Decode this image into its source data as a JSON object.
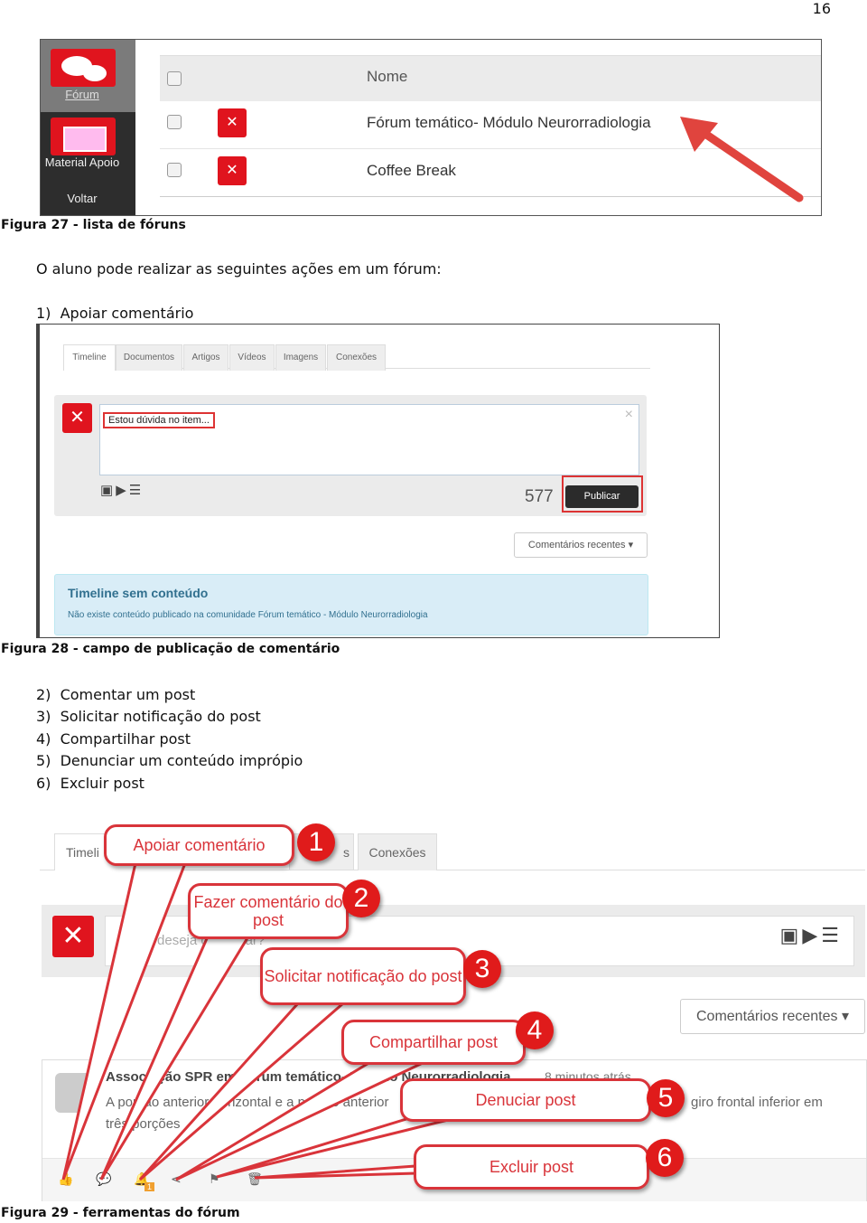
{
  "page_number": "16",
  "figure27": {
    "sidebar": [
      {
        "label": "Fórum",
        "icon": "chat-bubbles-icon"
      },
      {
        "label": "Material Apoio",
        "icon": "folder-icon"
      },
      {
        "label": "Voltar"
      }
    ],
    "header": "Nome",
    "rows": [
      "Fórum temático- Módulo Neurorradiologia",
      "Coffee Break"
    ],
    "caption": "Figura 27 - lista de fóruns"
  },
  "intro": "O aluno pode realizar as seguintes ações em um fórum:",
  "list1": [
    {
      "n": "1)",
      "t": "Apoiar comentário"
    }
  ],
  "figure28": {
    "tabs": [
      "Timeline",
      "Documentos",
      "Artigos",
      "Vídeos",
      "Imagens",
      "Conexões"
    ],
    "input_value": "Estou dúvida no item...",
    "close": "×",
    "char_count": "577",
    "publish": "Publicar",
    "sort": "Comentários recentes",
    "empty_title": "Timeline sem conteúdo",
    "empty_text": "Não existe conteúdo publicado na comunidade Fórum temático - Módulo Neurorradiologia",
    "caption": "Figura 28 - campo de publicação de comentário"
  },
  "list2": [
    {
      "n": "2)",
      "t": "Comentar um post"
    },
    {
      "n": "3)",
      "t": "Solicitar notificação do post"
    },
    {
      "n": "4)",
      "t": "Compartilhar post"
    },
    {
      "n": "5)",
      "t": "Denunciar um conteúdo imprópio"
    },
    {
      "n": "6)",
      "t": "Excluir post"
    }
  ],
  "figure29": {
    "tabs": [
      "Timeli",
      "s",
      "Conexões"
    ],
    "placeholder": "O que deseja comentar?",
    "sort": "Comentários recentes",
    "post_author": "Associação SPR em Fórum temático- Módulo Neurorradiologia",
    "post_time": "8 minutos atrás",
    "post_text1": "A porção anterior horizontal e a porção anterior",
    "post_text2": "giro frontal inferior em",
    "post_text3": "três porções",
    "badge": "1",
    "callouts": [
      {
        "n": "1",
        "t": "Apoiar comentário"
      },
      {
        "n": "2",
        "t": "Fazer comentário do post"
      },
      {
        "n": "3",
        "t": "Solicitar notificação do post"
      },
      {
        "n": "4",
        "t": "Compartilhar post"
      },
      {
        "n": "5",
        "t": "Denuciar post"
      },
      {
        "n": "6",
        "t": "Excluir post"
      }
    ],
    "caption": "Figura 29 - ferramentas do fórum"
  },
  "colors": {
    "brand_red": "#e0141e",
    "callout_red": "#d9343a",
    "info_bg": "#d9edf7"
  }
}
